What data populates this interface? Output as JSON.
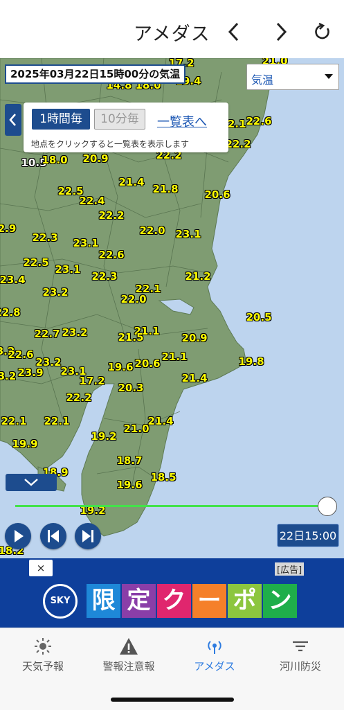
{
  "header": {
    "title": "アメダス"
  },
  "map": {
    "datetime": "2025年03月22日15時00分の気温",
    "element_select": "気温",
    "panel": {
      "hourly": "1時間毎",
      "ten_min": "10分毎",
      "list_link": "一覧表へ",
      "note": "地点をクリックすると一覧表を表示します"
    },
    "labels": [
      {
        "text": "17.2",
        "white": false
      },
      {
        "text": "21.0",
        "white": false
      },
      {
        "text": "14.8",
        "white": false
      },
      {
        "text": "18.0",
        "white": false
      },
      {
        "text": "19.4",
        "white": false
      },
      {
        "text": "22.1",
        "white": false
      },
      {
        "text": "22.6",
        "white": false
      },
      {
        "text": "22.2",
        "white": false
      },
      {
        "text": "10.5",
        "white": true
      },
      {
        "text": "18.0",
        "white": false
      },
      {
        "text": "20.9",
        "white": false
      },
      {
        "text": "22.2",
        "white": false
      },
      {
        "text": "22.5",
        "white": false
      },
      {
        "text": "21.4",
        "white": false
      },
      {
        "text": "21.8",
        "white": false
      },
      {
        "text": "20.6",
        "white": false
      },
      {
        "text": "22.4",
        "white": false
      },
      {
        "text": "22.2",
        "white": false
      },
      {
        "text": "2.9",
        "white": false
      },
      {
        "text": "22.3",
        "white": false
      },
      {
        "text": "22.0",
        "white": false
      },
      {
        "text": "23.1",
        "white": false
      },
      {
        "text": "23.1",
        "white": false
      },
      {
        "text": "22.6",
        "white": false
      },
      {
        "text": "22.5",
        "white": false
      },
      {
        "text": "23.1",
        "white": false
      },
      {
        "text": "23.4",
        "white": false
      },
      {
        "text": "22.3",
        "white": false
      },
      {
        "text": "21.2",
        "white": false
      },
      {
        "text": "22.1",
        "white": false
      },
      {
        "text": "23.2",
        "white": false
      },
      {
        "text": "22.0",
        "white": false
      },
      {
        "text": "22.8",
        "white": false
      },
      {
        "text": "20.5",
        "white": false
      },
      {
        "text": "22.7",
        "white": false
      },
      {
        "text": "23.2",
        "white": false
      },
      {
        "text": "21.1",
        "white": false
      },
      {
        "text": "21.5",
        "white": false
      },
      {
        "text": "20.9",
        "white": false
      },
      {
        "text": "3.2",
        "white": false
      },
      {
        "text": "22.6",
        "white": false
      },
      {
        "text": "21.1",
        "white": false
      },
      {
        "text": "23.2",
        "white": false
      },
      {
        "text": "19.6",
        "white": false
      },
      {
        "text": "20.6",
        "white": false
      },
      {
        "text": "19.8",
        "white": false
      },
      {
        "text": "3.2",
        "white": false
      },
      {
        "text": "23.9",
        "white": false
      },
      {
        "text": "23.1",
        "white": false
      },
      {
        "text": "17.2",
        "white": false
      },
      {
        "text": "21.4",
        "white": false
      },
      {
        "text": "20.3",
        "white": false
      },
      {
        "text": "22.2",
        "white": false
      },
      {
        "text": "22.1",
        "white": false
      },
      {
        "text": "22.1",
        "white": false
      },
      {
        "text": "21.4",
        "white": false
      },
      {
        "text": "21.0",
        "white": false
      },
      {
        "text": "19.2",
        "white": false
      },
      {
        "text": "19.9",
        "white": false
      },
      {
        "text": "18.7",
        "white": false
      },
      {
        "text": "18.9",
        "white": false
      },
      {
        "text": "18.5",
        "white": false
      },
      {
        "text": "19.6",
        "white": false
      },
      {
        "text": "19.2",
        "white": false
      },
      {
        "text": "18.2",
        "white": false
      }
    ],
    "time_display": "22日15:00",
    "slider_fraction": 1.0
  },
  "ad": {
    "close": "×",
    "tag": "[広告]",
    "logo": "SKY",
    "chars": [
      {
        "t": "限",
        "c": "#1e88d8"
      },
      {
        "t": "定",
        "c": "#8a3ea8"
      },
      {
        "t": "ク",
        "c": "#e0266e"
      },
      {
        "t": "ー",
        "c": "#f5802a"
      },
      {
        "t": "ポ",
        "c": "#8cc63e"
      },
      {
        "t": "ン",
        "c": "#1fae4a"
      }
    ]
  },
  "tabs": [
    {
      "label": "天気予報",
      "icon": "sun-icon",
      "active": false
    },
    {
      "label": "警報注意報",
      "icon": "warning-icon",
      "active": false
    },
    {
      "label": "アメダス",
      "icon": "signal-icon",
      "active": true
    },
    {
      "label": "河川防災",
      "icon": "filter-icon",
      "active": false
    }
  ],
  "colors": {
    "accent": "#1d4c8e",
    "land": "#7f9c72",
    "sea": "#bdd4ee",
    "values": "#ffff00",
    "active_tab": "#2d7be0"
  }
}
